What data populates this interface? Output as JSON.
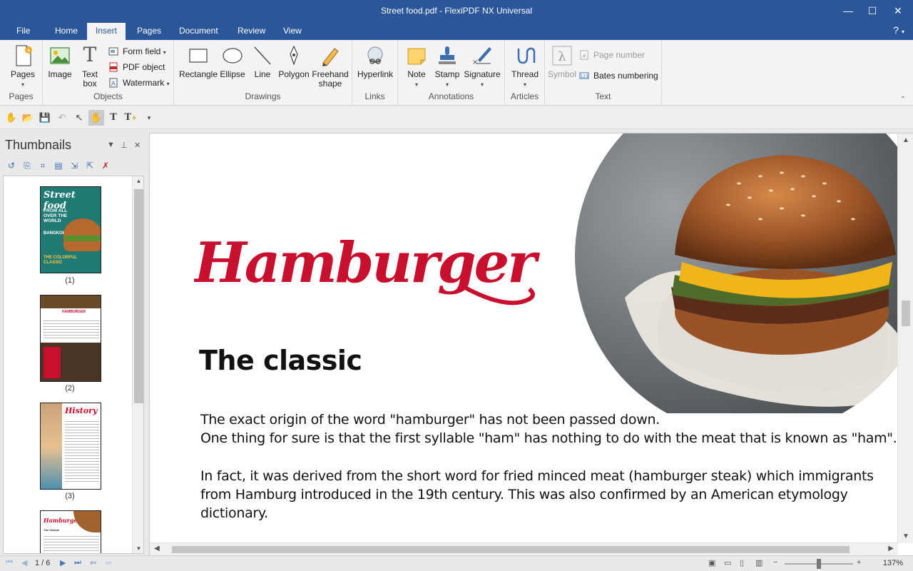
{
  "window": {
    "title": "Street food.pdf - FlexiPDF NX Universal",
    "minimize": "—",
    "maximize": "☐",
    "close": "✕"
  },
  "menu": {
    "tabs": [
      "File",
      "Home",
      "Insert",
      "Pages",
      "Document",
      "Review",
      "View"
    ],
    "active": "Insert",
    "help": "?"
  },
  "ribbon": {
    "groups": {
      "pages": "Pages",
      "objects": "Objects",
      "drawings": "Drawings",
      "links": "Links",
      "annotations": "Annotations",
      "articles": "Articles",
      "text": "Text"
    },
    "buttons": {
      "pages": "Pages",
      "image": "Image",
      "textbox_1": "Text",
      "textbox_2": "box",
      "form_field": "Form field",
      "pdf_object": "PDF object",
      "watermark": "Watermark",
      "rectangle": "Rectangle",
      "ellipse": "Ellipse",
      "line": "Line",
      "polygon": "Polygon",
      "freehand_1": "Freehand",
      "freehand_2": "shape",
      "hyperlink": "Hyperlink",
      "note": "Note",
      "stamp": "Stamp",
      "signature": "Signature",
      "thread": "Thread",
      "symbol": "Symbol",
      "page_number": "Page number",
      "bates_numbering": "Bates numbering"
    }
  },
  "thumbnails": {
    "title": "Thumbnails",
    "labels": [
      "(1)",
      "(2)",
      "(3)"
    ],
    "thumb1": {
      "title": "Street food",
      "lines": [
        "FROM ALL",
        "OVER THE",
        "WORLD",
        "BANGKOK",
        "THE COLORFUL",
        "CLASSIC"
      ]
    },
    "thumb2": {
      "title": "HAMBURGER"
    },
    "thumb3": {
      "title": "History"
    },
    "thumb4": {
      "title": "Hamburger",
      "sub": "The Classic"
    }
  },
  "document": {
    "title": "Hamburger",
    "heading": "The classic",
    "paragraphs": [
      "The exact origin of the word \"hamburger\" has not been passed down.",
      "One thing for sure is that the first syllable \"ham\" has nothing to do with the meat that is known as \"ham\".",
      "In fact, it was derived from the short word for fried minced meat (hamburger steak) which immigrants",
      "from Hamburg introduced in the 19th century. This was also confirmed by an American etymology",
      "dictionary."
    ]
  },
  "status": {
    "page_indicator": "1 / 6",
    "zoom": "137%",
    "zoom_fraction": 0.5
  },
  "colors": {
    "brand": "#2b579a",
    "title_red": "#c8102e"
  }
}
